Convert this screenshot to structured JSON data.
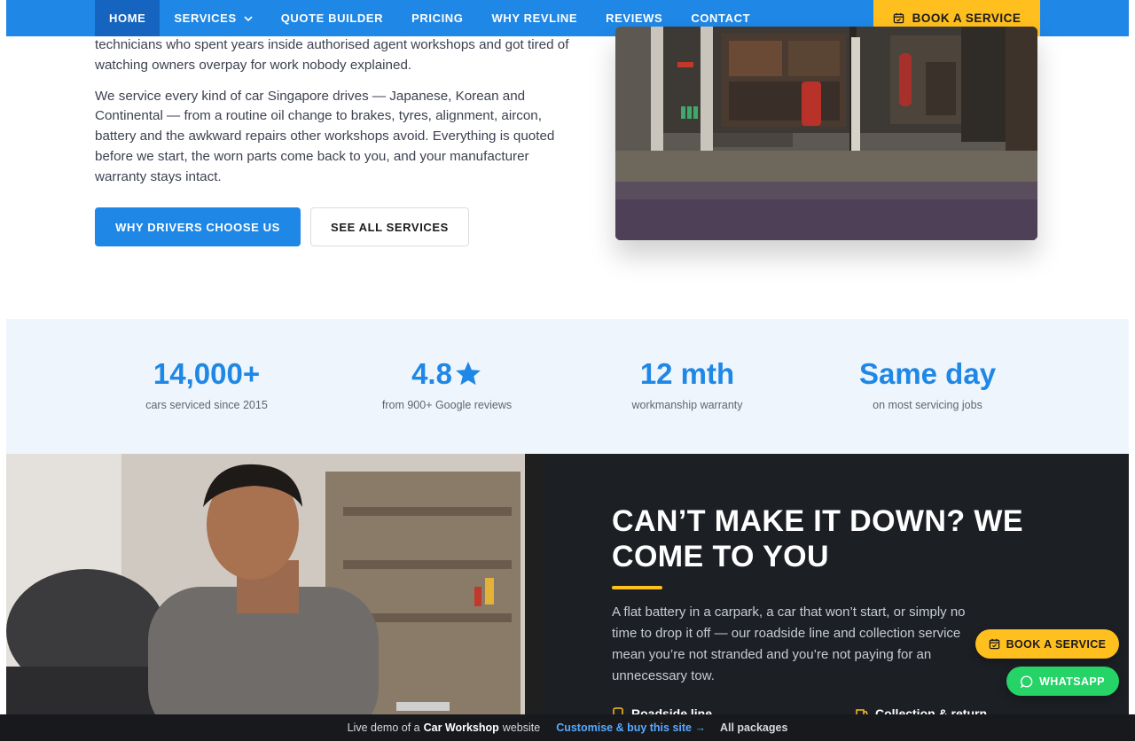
{
  "nav": {
    "items": [
      {
        "label": "HOME"
      },
      {
        "label": "SERVICES"
      },
      {
        "label": "QUOTE BUILDER"
      },
      {
        "label": "PRICING"
      },
      {
        "label": "WHY REVLINE"
      },
      {
        "label": "REVIEWS"
      },
      {
        "label": "CONTACT"
      }
    ],
    "cta": "BOOK A SERVICE"
  },
  "intro": {
    "p1": "technicians who spent years inside authorised agent workshops and got tired of watching owners overpay for work nobody explained.",
    "p2": "We service every kind of car Singapore drives — Japanese, Korean and Continental — from a routine oil change to brakes, tyres, alignment, aircon, battery and the awkward repairs other workshops avoid. Everything is quoted before we start, the worn parts come back to you, and your manufacturer warranty stays intact.",
    "primary_button": "WHY DRIVERS CHOOSE US",
    "secondary_button": "SEE ALL SERVICES"
  },
  "stats": [
    {
      "value": "14,000+",
      "label": "cars serviced since 2015"
    },
    {
      "value": "4.8",
      "label": "from 900+ Google reviews"
    },
    {
      "value": "12 mth",
      "label": "workmanship warranty"
    },
    {
      "value": "Same day",
      "label": "on most servicing jobs"
    }
  ],
  "mobile": {
    "heading": "CAN’T MAKE IT DOWN? WE COME TO YOU",
    "text": "A flat battery in a carpark, a car that won’t start, or simply no time to drop it off — our roadside line and collection service mean you’re not stranded and you’re not paying for an unnecessary tow.",
    "features": [
      "Roadside line",
      "Collection & return"
    ]
  },
  "floating": {
    "book": "BOOK A SERVICE",
    "whatsapp": "WHATSAPP"
  },
  "demo_bar": {
    "prefix": "Live demo of a",
    "site_type": "Car Workshop",
    "suffix": "website",
    "customize": "Customise & buy this site →",
    "packages": "All packages"
  },
  "colors": {
    "primary": "#1f87e5",
    "accent": "#ffbf1f",
    "dark": "#1c1f24",
    "whatsapp": "#25d366"
  }
}
